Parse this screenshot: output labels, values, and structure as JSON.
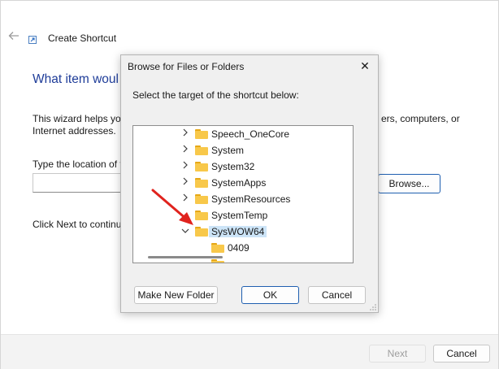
{
  "wizard": {
    "title": "Create Shortcut",
    "heading": "What item woul",
    "description_left": "This wizard helps you",
    "description_line2": "Internet addresses.",
    "description_right": "ers, computers, or",
    "location_label": "Type the location of t",
    "location_value": "",
    "browse_label": "Browse...",
    "next_instruction": "Click Next to continu",
    "next_label": "Next",
    "cancel_label": "Cancel"
  },
  "dialog": {
    "title": "Browse for Files or Folders",
    "close_glyph": "✕",
    "prompt": "Select the target of the shortcut below:",
    "tree": [
      {
        "label": "Speech_OneCore",
        "expanded": false,
        "level": 1
      },
      {
        "label": "System",
        "expanded": false,
        "level": 1
      },
      {
        "label": "System32",
        "expanded": false,
        "level": 1
      },
      {
        "label": "SystemApps",
        "expanded": false,
        "level": 1
      },
      {
        "label": "SystemResources",
        "expanded": false,
        "level": 1
      },
      {
        "label": "SystemTemp",
        "expanded": null,
        "level": 1
      },
      {
        "label": "SysWOW64",
        "expanded": true,
        "level": 1,
        "selected": true
      },
      {
        "label": "0409",
        "expanded": null,
        "level": 2
      }
    ],
    "make_folder_label": "Make New Folder",
    "ok_label": "OK",
    "cancel_label": "Cancel"
  },
  "colors": {
    "heading": "#1f3d99",
    "accent": "#1f5fb0",
    "folder": "#f8c84a",
    "selection": "#cce4f7",
    "arrow": "#e0231e"
  },
  "icons": {
    "back": "back-arrow-icon",
    "close": "close-icon",
    "folder": "folder-icon",
    "chevron_right": "chevron-right-icon",
    "chevron_down": "chevron-down-icon"
  }
}
